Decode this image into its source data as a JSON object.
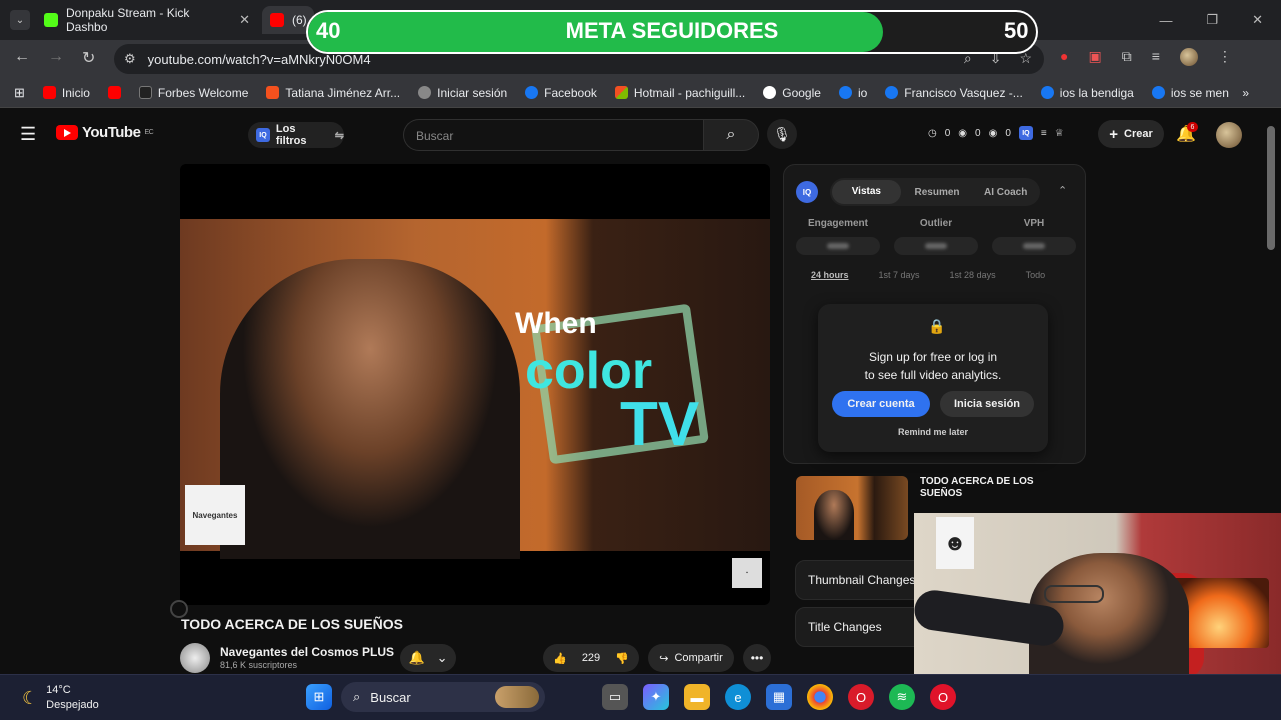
{
  "browser": {
    "tabs": [
      {
        "title": "Donpaku Stream - Kick Dashbo",
        "close": "✕"
      },
      {
        "title": "(6)"
      }
    ],
    "url": "youtube.com/watch?v=aMNkryN0OM4",
    "bookmarks": [
      "Inicio",
      "Forbes Welcome",
      "Tatiana Jiménez Arr...",
      "Iniciar sesión",
      "Facebook",
      "Hotmail - pachiguill...",
      "Google",
      "io",
      "Francisco Vasquez -...",
      "ios la bendiga",
      "ios se men"
    ]
  },
  "youtube": {
    "logo": "YouTube",
    "country": "EC",
    "filters_label": "Los filtros",
    "search_placeholder": "Buscar",
    "stats": [
      "0",
      "0",
      "0"
    ],
    "create_label": "Crear",
    "notif_count": "6",
    "video": {
      "overlay_when": "When",
      "overlay_color": "color",
      "overlay_tv": "TV",
      "watermark": "Navegantes",
      "title": "TODO ACERCA DE LOS SUEÑOS",
      "channel": "Navegantes del Cosmos PLUS",
      "subscribers": "81,6 K suscriptores",
      "likes": "229",
      "share_label": "Compartir"
    }
  },
  "analytics": {
    "tabs": [
      "Vistas",
      "Resumen",
      "AI Coach"
    ],
    "metrics": [
      "Engagement",
      "Outlier",
      "VPH"
    ],
    "ranges": [
      "24 hours",
      "1st 7 days",
      "1st 28 days",
      "Todo"
    ],
    "signup_line1": "Sign up for free or log in",
    "signup_line2": "to see full video analytics.",
    "create_account": "Crear cuenta",
    "login": "Inicia sesión",
    "remind": "Remind me later",
    "related_title": "TODO ACERCA DE LOS SUEÑOS",
    "thumbnail_changes": "Thumbnail Changes",
    "title_changes": "Title Changes"
  },
  "goal_overlay": {
    "start": "40",
    "title": "META SEGUIDORES",
    "end": "50",
    "progress": 0.79,
    "fill_color": "#22bb4a"
  },
  "taskbar": {
    "temp": "14°C",
    "condition": "Despejado",
    "search_label": "Buscar"
  }
}
